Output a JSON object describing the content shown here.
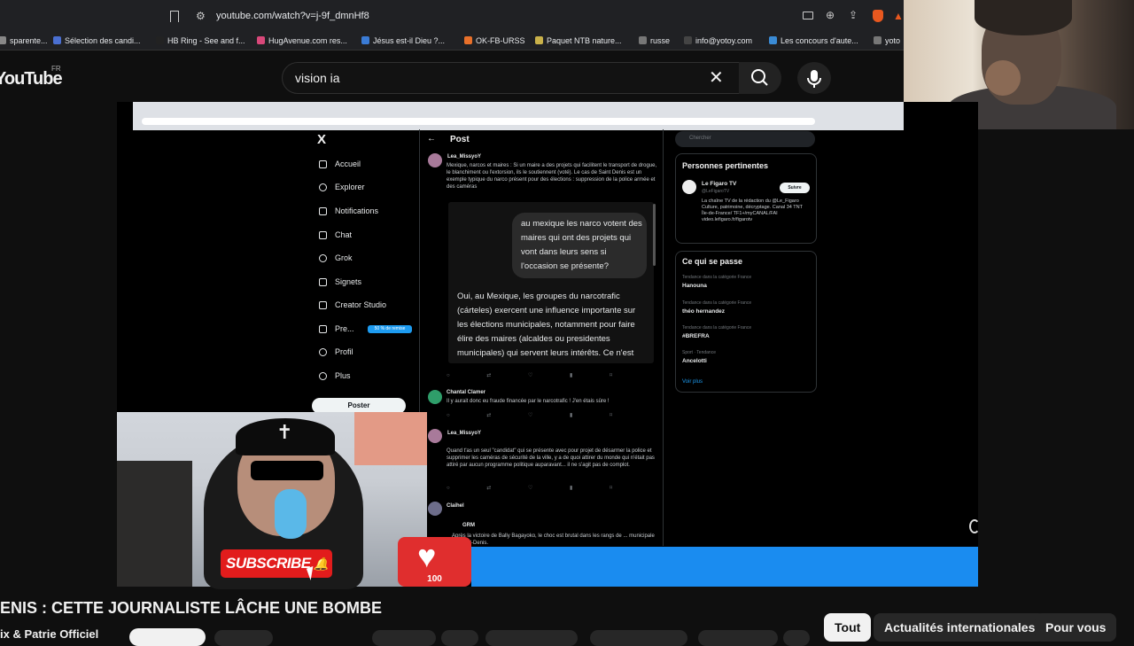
{
  "browser": {
    "url": "youtube.com/watch?v=j-9f_dmnHf8",
    "bookmarks": [
      {
        "label": "sparente...",
        "color": "#888888"
      },
      {
        "label": "Sélection des candi...",
        "color": "#4a6fd1"
      },
      {
        "label": "HB Ring - See and f...",
        "color": "#222222"
      },
      {
        "label": "HugAvenue.com res...",
        "color": "#d9487a"
      },
      {
        "label": "Jésus est-il Dieu ?...",
        "color": "#3a7bd5"
      },
      {
        "label": "OK-FB-URSS",
        "color": "#e8702a"
      },
      {
        "label": "Paquet NTB nature...",
        "color": "#c9b14a"
      },
      {
        "label": "russe",
        "color": "#777777"
      },
      {
        "label": "info@yotoy.com",
        "color": "#444444"
      },
      {
        "label": "Les concours d'aute...",
        "color": "#3a8bd5"
      },
      {
        "label": "yoto",
        "color": "#777777"
      }
    ]
  },
  "youtube": {
    "logo": "YouTube",
    "region": "FR",
    "search_value": "vision ia"
  },
  "x_app": {
    "nav": [
      {
        "label": "Accueil",
        "icon": "home-icon"
      },
      {
        "label": "Explorer",
        "icon": "search-icon"
      },
      {
        "label": "Notifications",
        "icon": "bell-icon"
      },
      {
        "label": "Chat",
        "icon": "mail-icon"
      },
      {
        "label": "Grok",
        "icon": "grok-icon"
      },
      {
        "label": "Signets",
        "icon": "bookmark-icon"
      },
      {
        "label": "Creator Studio",
        "icon": "rocket-icon"
      },
      {
        "label": "Pre...",
        "icon": "x-icon"
      },
      {
        "label": "Profil",
        "icon": "person-icon"
      },
      {
        "label": "Plus",
        "icon": "more-icon"
      }
    ],
    "premium_badge": "50 % de remise",
    "post_button": "Poster",
    "post_header": "Post",
    "tweet1_name": "Lea_MissyoY",
    "tweet1_text": "Mexique, narcos et maires : Si un maire a des projets qui facilitent le transport de drogue, le blanchiment ou l'extorsion, ils le soutiennent (voté). Le cas de Saint Denis est un exemple typique du narco présent pour des élections : suppression de la police armée et des caméras",
    "question": "au mexique les narco votent des maires qui ont des projets qui vont dans leurs sens si l'occasion se présente?",
    "answer": "Oui, au Mexique, les groupes du narcotrafic (cárteles) exercent une influence importante sur les élections municipales, notamment pour faire élire des maires (alcaldes ou presidentes municipales) qui servent leurs intérêts. Ce n'est",
    "tweet2_name": "Chantal Clamer",
    "tweet2_text": "Il y aurait donc eu fraude financée par le narcotrafic ! J'en étais sûre !",
    "tweet3_name": "Lea_MissyoY",
    "tweet3_text": "Quand t'as un seul \"candidat\" qui se présente avec pour projet de désarmer la police et supprimer les caméras de sécurité de la ville, y a de quoi attirer du monde qui n'était pas attiré par aucun programme politique auparavant... il ne s'agit pas de complot.",
    "tweet4_name": "Claihel",
    "tweet4_quote_name": "GRM",
    "tweet4_text": "Après la victoire de Bally Bagayoko, le choc est brutal dans les rangs de ... municipale de Saint-Denis.",
    "right_search": "Chercher",
    "relevant_heading": "Personnes pertinentes",
    "relevant_name": "Le Figaro TV",
    "relevant_handle": "@LeFigaroTV",
    "follow_label": "Suivre",
    "relevant_bio": "La chaîne TV de la rédaction du @Le_Figaro Culture, patrimoine, décryptage. Canal 34 TNT Île-de-France/ TF1+/myCANAL/FAI video.lefigaro.fr/figarotv",
    "trends_heading": "Ce qui se passe",
    "trends": [
      {
        "context": "Tendance dans la catégorie France",
        "title": "Hanouna"
      },
      {
        "context": "Tendance dans la catégorie France",
        "title": "théo hernandez"
      },
      {
        "context": "Tendance dans la catégorie France",
        "title": "#BREFRA"
      },
      {
        "context": "Sport · Tendance",
        "title": "Ancelotti"
      }
    ],
    "show_more": "Voir plus"
  },
  "overlay": {
    "subscribe_label": "SUBSCRIBE",
    "like_count": "100"
  },
  "video": {
    "title": "ENIS : CETTE JOURNALISTE LÂCHE UNE BOMBE",
    "channel": "ix & Patrie Officiel"
  },
  "chips": [
    "Tout",
    "Actualités internationales",
    "Pour vous"
  ]
}
